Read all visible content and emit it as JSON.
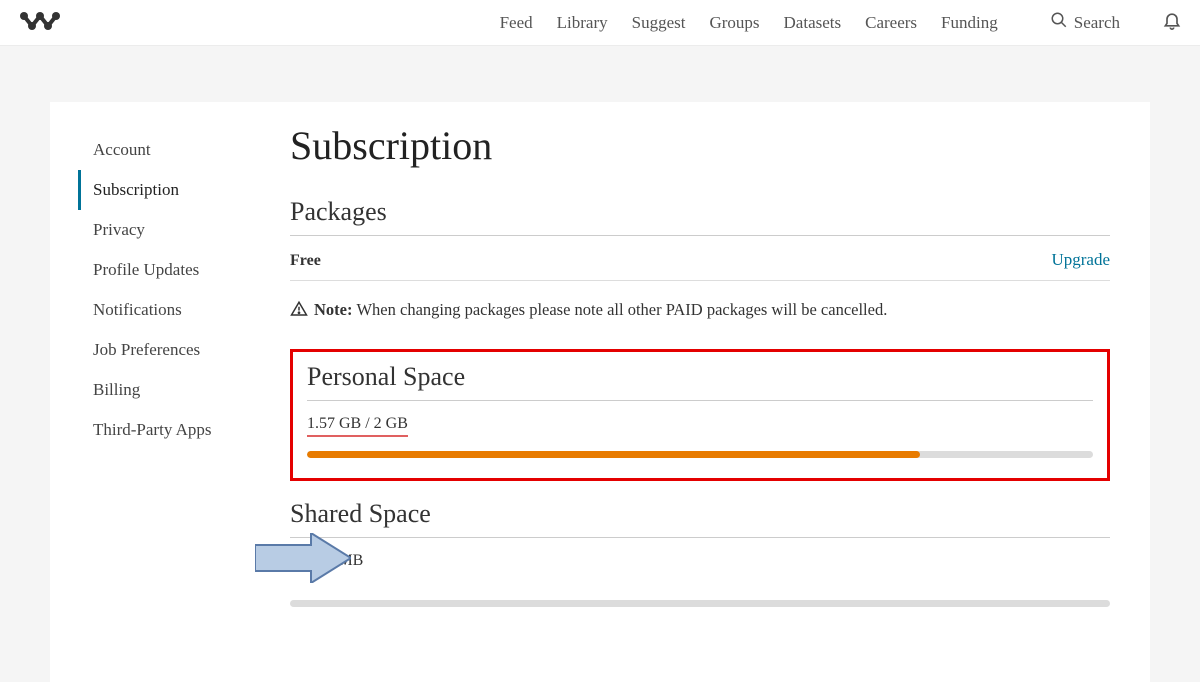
{
  "nav": {
    "items": [
      "Feed",
      "Library",
      "Suggest",
      "Groups",
      "Datasets",
      "Careers",
      "Funding"
    ],
    "search_label": "Search"
  },
  "sidebar": {
    "items": [
      {
        "label": "Account"
      },
      {
        "label": "Subscription"
      },
      {
        "label": "Privacy"
      },
      {
        "label": "Profile Updates"
      },
      {
        "label": "Notifications"
      },
      {
        "label": "Job Preferences"
      },
      {
        "label": "Billing"
      },
      {
        "label": "Third-Party Apps"
      }
    ],
    "active_index": 1
  },
  "main": {
    "title": "Subscription",
    "packages": {
      "heading": "Packages",
      "current": "Free",
      "upgrade_label": "Upgrade",
      "note_label": "Note:",
      "note_text": "When changing packages please note all other PAID packages will be cancelled."
    },
    "personal_space": {
      "heading": "Personal Space",
      "usage_text": "1.57 GB / 2 GB",
      "fill_percent": 78
    },
    "shared_space": {
      "heading": "Shared Space",
      "usage_text": "0 / 100 MB",
      "fill_percent": 0
    }
  }
}
